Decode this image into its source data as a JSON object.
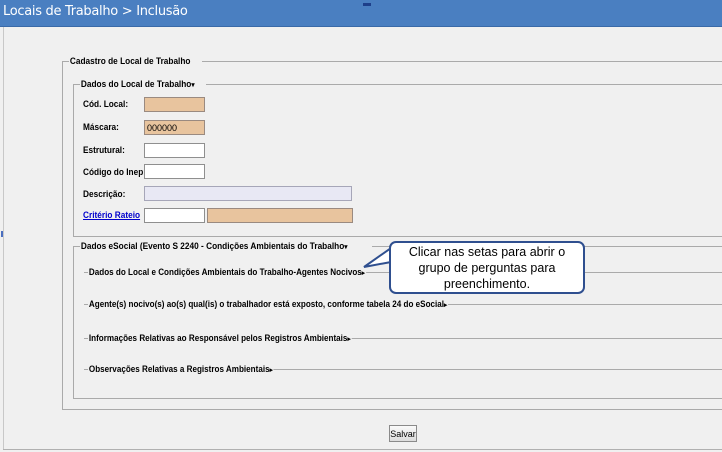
{
  "window": {
    "title": "Locais de Trabalho > Inclusão"
  },
  "form": {
    "outer_legend": "Cadastro de Local de Trabalho",
    "section1": {
      "legend": "Dados do Local de Trabalho",
      "legend_arrow": "▾",
      "fields": {
        "cod_local": {
          "label": "Cód. Local:",
          "value": ""
        },
        "mascara": {
          "label": "Máscara:",
          "value": "000000"
        },
        "estrutural": {
          "label": "Estrutural:",
          "value": ""
        },
        "codigo_inep": {
          "label": "Código do Inep:",
          "value": ""
        },
        "descricao": {
          "label": "Descrição:",
          "value": ""
        },
        "criterio_rateio": {
          "label": "Critério Rateio",
          "code_value": "",
          "desc_value": ""
        }
      }
    },
    "section2": {
      "legend": "Dados eSocial (Evento S 2240 - Condições Ambientais do Trabalho",
      "legend_arrow": "▾",
      "subsections": [
        {
          "label": "Dados do Local e Condições Ambientais do Trabalho-Agentes Nocivos",
          "arrow": "▸"
        },
        {
          "label": "Agente(s) nocivo(s) ao(s) qual(is) o trabalhador está exposto, conforme tabela 24 do eSocial",
          "arrow": "▸"
        },
        {
          "label": "Informações Relativas ao Responsável pelos Registros Ambientais",
          "arrow": "▸"
        },
        {
          "label": "Observações Relativas a Registros Ambientais",
          "arrow": "▸"
        }
      ]
    },
    "save_label": "Salvar"
  },
  "callout": {
    "line1": "Clicar nas setas para abrir o",
    "line2": "grupo de perguntas para",
    "line3": "preenchimento."
  },
  "colors": {
    "titlebar": "#4a7fc1",
    "readonly_field": "#e8c49e",
    "description_field": "#e8e8f4",
    "callout_border": "#2f4f8f"
  }
}
